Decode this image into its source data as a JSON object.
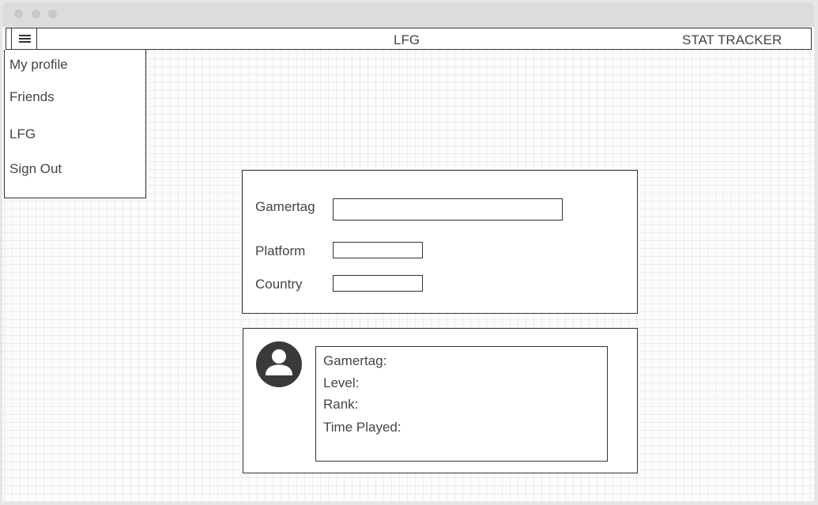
{
  "navbar": {
    "menu_icon": "hamburger-menu-icon",
    "center_title": "LFG",
    "right_link": "STAT TRACKER"
  },
  "side_menu": {
    "items": [
      {
        "label": "My profile"
      },
      {
        "label": "Friends"
      },
      {
        "label": "LFG"
      },
      {
        "label": "Sign Out"
      }
    ]
  },
  "search_form": {
    "gamertag_label": "Gamertag",
    "gamertag_value": "",
    "platform_label": "Platform",
    "platform_value": "",
    "country_label": "Country",
    "country_value": ""
  },
  "player_card": {
    "avatar_icon": "user-avatar-icon",
    "gamertag_label": "Gamertag:",
    "level_label": "Level:",
    "rank_label": "Rank:",
    "time_played_label": "Time Played:"
  },
  "colors": {
    "border": "#333333",
    "text": "#444444",
    "grid": "#ebebeb",
    "titlebar": "#dcdcdc"
  }
}
